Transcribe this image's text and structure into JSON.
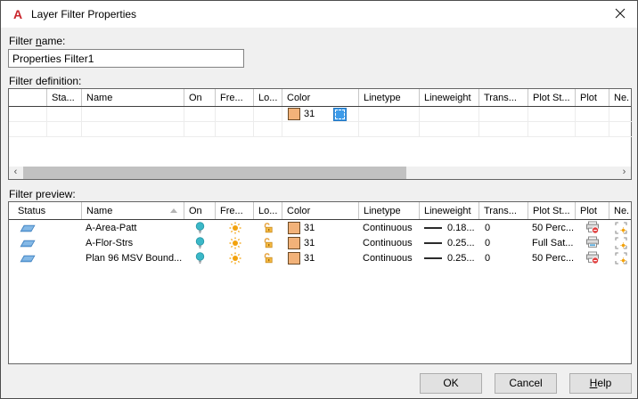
{
  "window": {
    "title": "Layer Filter Properties",
    "logo_letter": "A",
    "close_icon": "close-x"
  },
  "filter_name": {
    "label_pre": "Filter ",
    "label_underline": "n",
    "label_post": "ame:",
    "value": "Properties Filter1"
  },
  "definition": {
    "section_label": "Filter definition:",
    "columns": {
      "selector": "",
      "status": "Sta...",
      "name": "Name",
      "on": "On",
      "freeze": "Fre...",
      "lock": "Lo...",
      "color": "Color",
      "linetype": "Linetype",
      "lineweight": "Lineweight",
      "transparency": "Trans...",
      "plot_style": "Plot St...",
      "plot": "Plot",
      "new_vp": "Ne."
    },
    "criteria_row": {
      "color": "31"
    },
    "scrollbar": {
      "left_arrow": "‹",
      "right_arrow": "›"
    }
  },
  "preview": {
    "section_label": "Filter preview:",
    "columns": {
      "status": "Status",
      "name": "Name",
      "on": "On",
      "freeze": "Fre...",
      "lock": "Lo...",
      "color": "Color",
      "linetype": "Linetype",
      "lineweight": "Lineweight",
      "transparency": "Trans...",
      "plot_style": "Plot St...",
      "plot": "Plot",
      "new_vp": "Ne."
    },
    "sort": {
      "column": "Name",
      "direction": "ascending"
    },
    "rows": [
      {
        "name": "A-Area-Patt",
        "on": "on",
        "freeze": "thawed",
        "lock": "unlocked",
        "color": "31",
        "linetype": "Continuous",
        "lineweight": "0.18...",
        "transparency": "0",
        "plot_style": "50 Perc...",
        "plot": "no-plot",
        "new_vp": "thawed"
      },
      {
        "name": "A-Flor-Strs",
        "on": "on",
        "freeze": "thawed",
        "lock": "unlocked",
        "color": "31",
        "linetype": "Continuous",
        "lineweight": "0.25...",
        "transparency": "0",
        "plot_style": "Full Sat...",
        "plot": "plot",
        "new_vp": "thawed"
      },
      {
        "name": "Plan 96 MSV Bound...",
        "on": "on",
        "freeze": "thawed",
        "lock": "unlocked",
        "color": "31",
        "linetype": "Continuous",
        "lineweight": "0.25...",
        "transparency": "0",
        "plot_style": "50 Perc...",
        "plot": "no-plot",
        "new_vp": "thawed"
      }
    ]
  },
  "buttons": {
    "ok": "OK",
    "cancel": "Cancel",
    "help_underline": "H",
    "help_post": "elp"
  },
  "colors": {
    "aci_31_swatch": "#F2B279",
    "selection_blue": "#3D9BE9",
    "icon_orange": "#F2A20D",
    "icon_teal": "#3BB8C8",
    "status_blue": "#5B9BD5"
  }
}
